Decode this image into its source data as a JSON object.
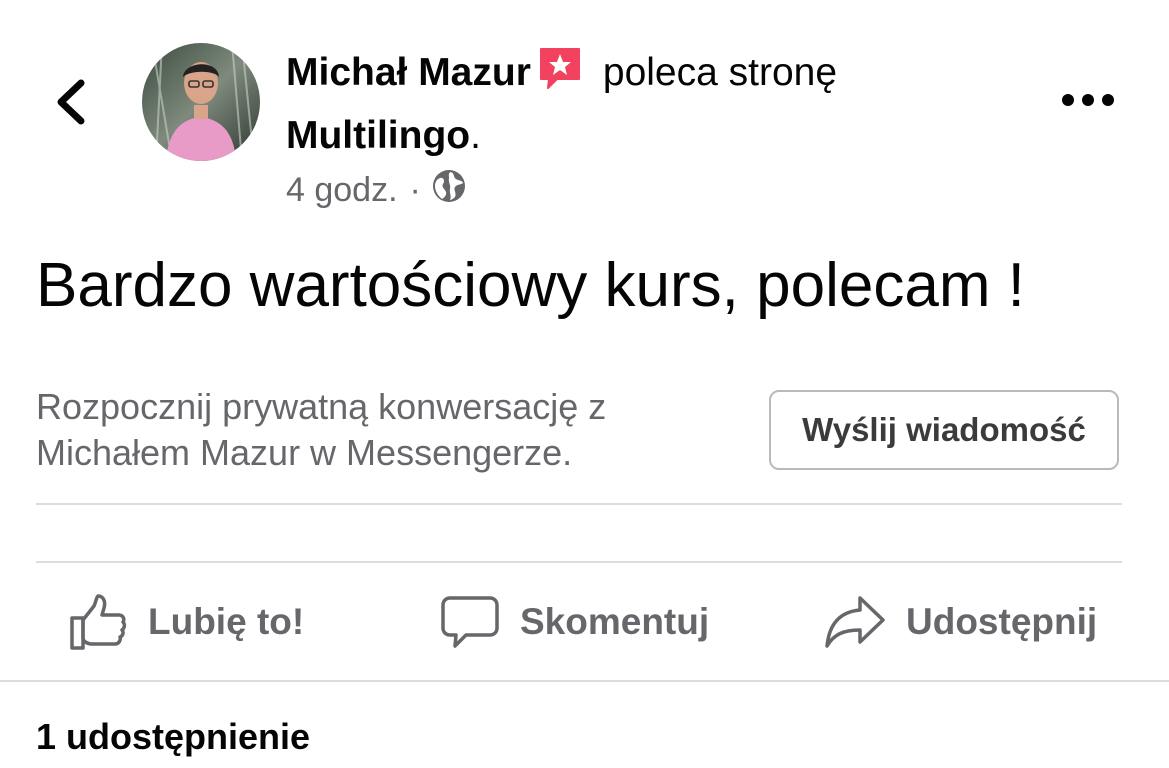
{
  "header": {
    "author_name": "Michał Mazur",
    "action_text": "poleca stronę",
    "page_name": "Multilingo",
    "trailing_period": ".",
    "timestamp": "4 godz.",
    "separator": "·",
    "privacy_icon": "globe-icon",
    "badge_icon": "recommendation-star-icon",
    "back_icon": "chevron-left-icon",
    "more_icon": "more-horizontal-icon"
  },
  "post": {
    "text": "Bardzo wartościowy kurs, polecam !"
  },
  "messenger": {
    "prompt": "Rozpocznij prywatną konwersację z Michałem Mazur w Messengerze.",
    "button_label": "Wyślij wiadomość"
  },
  "actions": [
    {
      "label": "Lubię to!",
      "icon": "thumbs-up-icon"
    },
    {
      "label": "Skomentuj",
      "icon": "comment-icon"
    },
    {
      "label": "Udostępnij",
      "icon": "share-icon"
    }
  ],
  "stats": {
    "shares_text": "1 udostępnienie"
  },
  "colors": {
    "primary_text": "#050505",
    "secondary_text": "#65676b",
    "divider": "#dadde1",
    "badge": "#f3425f"
  }
}
